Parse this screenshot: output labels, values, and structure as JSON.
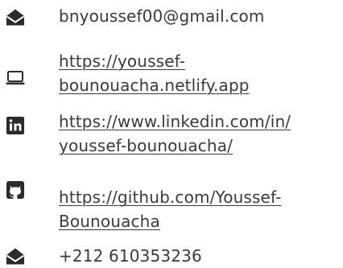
{
  "contacts": {
    "email": {
      "icon": "envelope-open-icon",
      "text": "bnyoussef00@gmail.com"
    },
    "website": {
      "icon": "laptop-icon",
      "lines": [
        "https://youssef-",
        "bounouacha.netlify.app"
      ]
    },
    "linkedin": {
      "icon": "linkedin-icon",
      "lines": [
        "https://www.linkedin.com/in/",
        "youssef-bounouacha/"
      ]
    },
    "github": {
      "icon": "github-icon",
      "lines": [
        "https://github.com/Youssef-",
        "Bounouacha"
      ]
    },
    "phone": {
      "icon": "envelope-open-icon",
      "text": "+212 610353236"
    }
  },
  "colors": {
    "text": "#3a3a3a",
    "icon": "#2b2b2b"
  }
}
